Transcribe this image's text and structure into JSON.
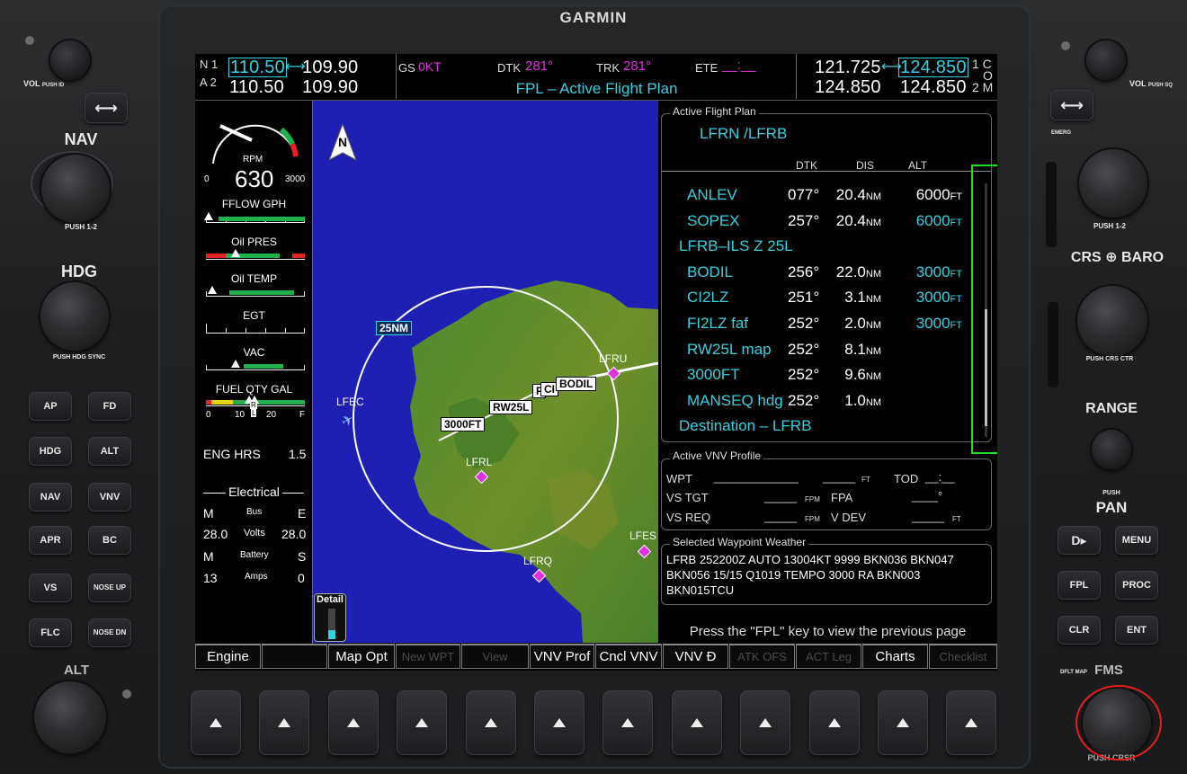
{
  "bezel": {
    "brand": "GARMIN",
    "left": {
      "vol_label": "VOL",
      "vol_push": "PUSH ID",
      "nav_label": "NAV",
      "nav_push": "PUSH 1-2",
      "hdg_label": "HDG",
      "hdg_push": "PUSH HDG SYNC",
      "alt_label": "ALT",
      "keys": [
        "AP",
        "FD",
        "HDG",
        "ALT",
        "NAV",
        "VNV",
        "APR",
        "BC",
        "VS",
        "NOSE UP",
        "FLC",
        "NOSE DN"
      ]
    },
    "right": {
      "vol_label": "VOL",
      "vol_push": "PUSH SQ",
      "emerg": "EMERG",
      "com_push": "PUSH 1-2",
      "crs": "CRS",
      "baro": "BARO",
      "crs_push": "PUSH CRS CTR",
      "range": "RANGE",
      "pan_push": "PUSH",
      "pan": "PAN",
      "keys": [
        "D▸",
        "MENU",
        "FPL",
        "PROC",
        "CLR",
        "ENT"
      ],
      "dflt_map": "DFLT MAP",
      "fms": "FMS",
      "fms_push": "PUSH CRSR"
    }
  },
  "topbar": {
    "nav_label_1": "N 1",
    "nav_label_2": "A 2",
    "nav1_active": "110.50",
    "nav1_standby": "109.90",
    "nav2_active": "110.50",
    "nav2_standby": "109.90",
    "gs_label": "GS",
    "gs_value": "0KT",
    "dtk_label": "DTK",
    "dtk_value": "281°",
    "trk_label": "TRK",
    "trk_value": "281°",
    "ete_label": "ETE",
    "ete_value": "__:__",
    "page_title": "FPL – Active Flight Plan",
    "com1_active": "121.725",
    "com1_standby": "124.850",
    "com2_active": "124.850",
    "com2_standby": "124.850",
    "com_label_1": "1 C",
    "com_label_o": "O",
    "com_label_2": "2 M"
  },
  "eis": {
    "rpm_label": "RPM",
    "rpm_value": "630",
    "rpm_min": "0",
    "rpm_max": "3000",
    "fflow": "FFLOW GPH",
    "oil_pres": "Oil PRES",
    "oil_temp": "Oil TEMP",
    "egt": "EGT",
    "vac": "VAC",
    "fuel_qty": "FUEL QTY GAL",
    "fuel_ticks": [
      "0",
      "10",
      "20",
      "F"
    ],
    "fuel_tags": [
      "L",
      "R"
    ],
    "eng_hrs_label": "ENG HRS",
    "eng_hrs_value": "1.5",
    "electrical": "Electrical",
    "bus_label": "Bus",
    "bus_m": "M",
    "bus_e": "E",
    "volts_m": "28.0",
    "volts_label": "Volts",
    "volts_e": "28.0",
    "battery_m": "M",
    "battery_label": "Battery",
    "battery_s": "S",
    "amps_m": "13",
    "amps_label": "Amps",
    "amps_s": "0"
  },
  "map": {
    "north": "N",
    "range": "25NM",
    "airports": [
      "LFEC",
      "LFRU",
      "LFRL",
      "LFES",
      "LFRQ"
    ],
    "waypoints": [
      "BODIL",
      "CI",
      "F",
      "RW25L",
      "3000FT"
    ],
    "detail_label": "Detail"
  },
  "fpl": {
    "title": "Active Flight Plan",
    "route": "LFRN /LFRB",
    "col_dtk": "DTK",
    "col_dis": "DIS",
    "col_alt": "ALT",
    "rows": [
      {
        "wpt": "ANLEV",
        "dtk": "077°",
        "dis": "20.4",
        "dis_unit": "NM",
        "alt": "6000",
        "alt_unit": "FT",
        "alt_color": "#ffffff"
      },
      {
        "wpt": "SOPEX",
        "dtk": "257°",
        "dis": "20.4",
        "dis_unit": "NM",
        "alt": "6000",
        "alt_unit": "FT",
        "alt_color": "#36d1e0"
      },
      {
        "wpt": "LFRB–ILS Z 25L",
        "header": true
      },
      {
        "wpt": "BODIL",
        "dtk": "256°",
        "dis": "22.0",
        "dis_unit": "NM",
        "alt": "3000",
        "alt_unit": "FT",
        "alt_color": "#36d1e0"
      },
      {
        "wpt": "CI2LZ",
        "dtk": "251°",
        "dis": "3.1",
        "dis_unit": "NM",
        "alt": "3000",
        "alt_unit": "FT",
        "alt_color": "#36d1e0"
      },
      {
        "wpt": "FI2LZ faf",
        "dtk": "252°",
        "dis": "2.0",
        "dis_unit": "NM",
        "alt": "3000",
        "alt_unit": "FT",
        "alt_color": "#36d1e0"
      },
      {
        "wpt": "RW25L map",
        "dtk": "252°",
        "dis": "8.1",
        "dis_unit": "NM",
        "alt": "",
        "alt_unit": "",
        "alt_color": "#ffffff"
      },
      {
        "wpt": "3000FT",
        "dtk": "252°",
        "dis": "9.6",
        "dis_unit": "NM",
        "alt": "",
        "alt_unit": "",
        "alt_color": "#ffffff"
      },
      {
        "wpt": "MANSEQ hdg",
        "dtk": "252°",
        "dis": "1.0",
        "dis_unit": "NM",
        "alt": "",
        "alt_unit": "",
        "alt_color": "#ffffff"
      }
    ],
    "destination": "Destination – LFRB",
    "vnv_title": "Active VNV Profile",
    "vnv_wpt": "WPT",
    "vnv_wpt_val": "_____________",
    "vnv_wpt_alt": "_____",
    "vnv_ft": "FT",
    "vnv_tod": "TOD",
    "vnv_tod_val": "__:__",
    "vnv_vstgt": "VS TGT",
    "vnv_vstgt_val": "_____",
    "vnv_fpm": "FPM",
    "vnv_fpa": "FPA",
    "vnv_fpa_val": "____°",
    "vnv_vsreq": "VS REQ",
    "vnv_vsreq_val": "_____",
    "vnv_vdev": "V DEV",
    "vnv_vdev_val": "_____",
    "wx_title": "Selected Waypoint Weather",
    "wx_text": "LFRB 252200Z AUTO 13004KT 9999 BKN036 BKN047 BKN056 15/15 Q1019 TEMPO 3000 RA BKN003 BKN015TCU",
    "footer": "Press the \"FPL\" key to view the previous page"
  },
  "softkeys": [
    {
      "label": "Engine",
      "enabled": true
    },
    {
      "label": "",
      "enabled": true
    },
    {
      "label": "Map Opt",
      "enabled": true
    },
    {
      "label": "New WPT",
      "enabled": false
    },
    {
      "label": "View",
      "enabled": false
    },
    {
      "label": "VNV Prof",
      "enabled": true
    },
    {
      "label": "Cncl VNV",
      "enabled": true
    },
    {
      "label": "VNV Đ",
      "enabled": true
    },
    {
      "label": "ATK OFS",
      "enabled": false
    },
    {
      "label": "ACT Leg",
      "enabled": false
    },
    {
      "label": "Charts",
      "enabled": true
    },
    {
      "label": "Checklist",
      "enabled": false
    }
  ],
  "colors": {
    "cyan": "#36d1e0",
    "magenta": "#e030e0",
    "highlight_green": "#22dd22",
    "highlight_red": "#e02020"
  }
}
